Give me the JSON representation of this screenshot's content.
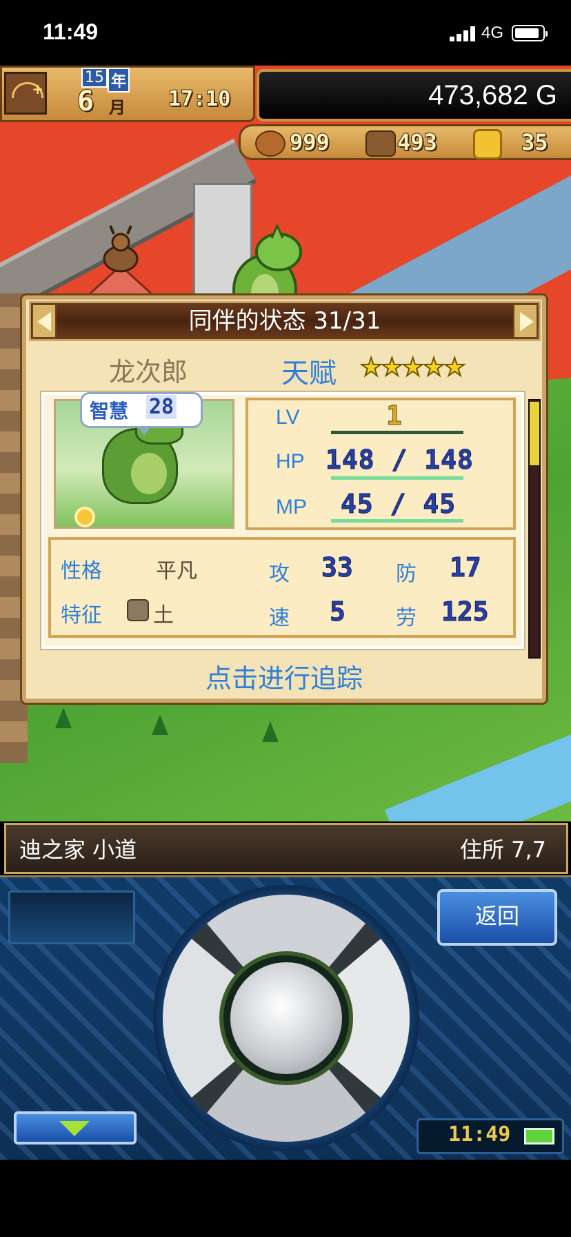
{
  "status_bar": {
    "time": "11:49",
    "network": "4G"
  },
  "hud": {
    "year_num": "15",
    "year_label": "年",
    "month_num": "6",
    "month_label": "月",
    "time": "17:10",
    "money": "473,682 G",
    "resources": {
      "food": "999",
      "wood": "493",
      "ore": "35"
    },
    "icons": [
      "clock-compass-icon",
      "food-meat-icon",
      "wood-log-icon",
      "ore-nugget-icon"
    ]
  },
  "dialog": {
    "title": "同伴的状态 31/31",
    "character_name": "龙次郎",
    "talent_label": "天赋",
    "talent_stars": "★★★★★",
    "bubble": {
      "label": "智慧",
      "value": "28"
    },
    "stats": {
      "lv_label": "LV",
      "lv_value": "1",
      "hp_label": "HP",
      "hp_value": "148 / 148",
      "mp_label": "MP",
      "mp_value": "45 / 45"
    },
    "attributes": {
      "nature_label": "性格",
      "nature_value": "平凡",
      "trait_label": "特征",
      "trait_value": "土",
      "atk_label": "攻",
      "atk_value": "33",
      "def_label": "防",
      "def_value": "17",
      "spd_label": "速",
      "spd_value": "5",
      "labor_label": "劳",
      "labor_value": "125"
    },
    "track_link": "点击进行追踪"
  },
  "location": {
    "name": "迪之家 小道",
    "coord": "住所  7,7"
  },
  "controller": {
    "back_label": "返回",
    "clock": "11:49"
  },
  "colors": {
    "accent_blue": "#2f7fd8",
    "panel_cream": "#f4e3b6",
    "frame_gold": "#c9a667",
    "controller_blue": "#113864",
    "star_yellow": "#f6d21c"
  }
}
